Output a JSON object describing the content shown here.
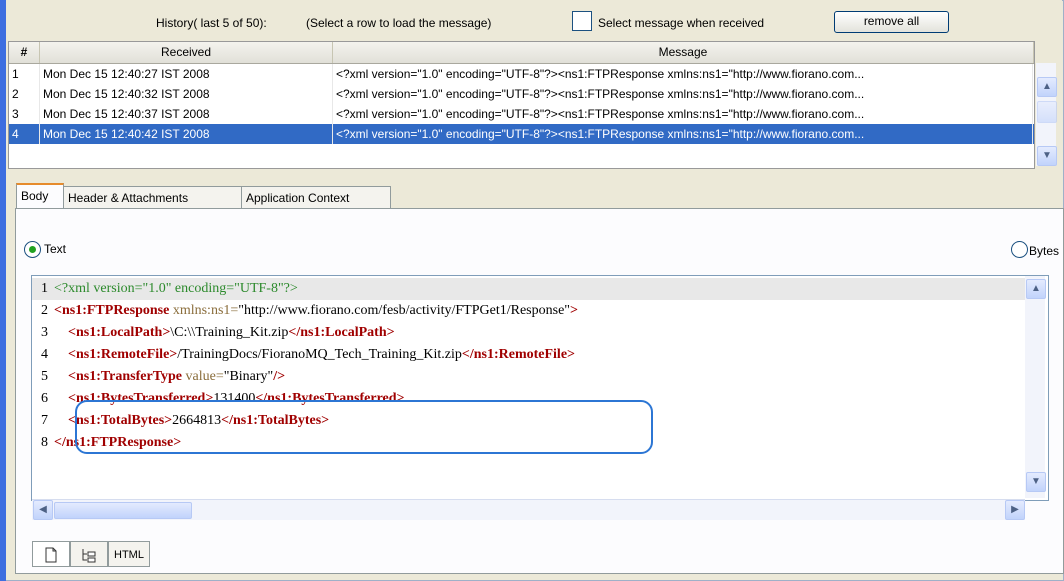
{
  "history": {
    "title": "History( last 5 of 50):",
    "hint": "(Select a row to load the message)",
    "select_when_received_label": "Select message when received",
    "remove_all_label": "remove all"
  },
  "table": {
    "columns": [
      "#",
      "Received",
      "Message"
    ],
    "rows": [
      {
        "num": "1",
        "received": "Mon Dec 15 12:40:27 IST 2008",
        "message": "<?xml version=\"1.0\" encoding=\"UTF-8\"?><ns1:FTPResponse xmlns:ns1=\"http://www.fiorano.com..."
      },
      {
        "num": "2",
        "received": "Mon Dec 15 12:40:32 IST 2008",
        "message": "<?xml version=\"1.0\" encoding=\"UTF-8\"?><ns1:FTPResponse xmlns:ns1=\"http://www.fiorano.com..."
      },
      {
        "num": "3",
        "received": "Mon Dec 15 12:40:37 IST 2008",
        "message": "<?xml version=\"1.0\" encoding=\"UTF-8\"?><ns1:FTPResponse xmlns:ns1=\"http://www.fiorano.com..."
      },
      {
        "num": "4",
        "received": "Mon Dec 15 12:40:42 IST 2008",
        "message": "<?xml version=\"1.0\" encoding=\"UTF-8\"?><ns1:FTPResponse xmlns:ns1=\"http://www.fiorano.com..."
      }
    ],
    "selected_row": 4
  },
  "tabs": [
    "Body",
    "Header & Attachments",
    "Application Context"
  ],
  "active_tab": "Body",
  "format": {
    "text_label": "Text",
    "bytes_label": "Bytes",
    "selected": "Text"
  },
  "editor": {
    "lines": [
      {
        "n": "1",
        "parts": [
          [
            "pi",
            "<?xml version=\"1.0\" encoding=\"UTF-8\"?>"
          ]
        ]
      },
      {
        "n": "2",
        "parts": [
          [
            "tag",
            "<ns1:FTPResponse"
          ],
          [
            "attr",
            " xmlns:ns1="
          ],
          [
            "str",
            "\"http://www.fiorano.com/fesb/activity/FTPGet1/Response\""
          ],
          [
            "tag",
            ">"
          ]
        ]
      },
      {
        "n": "3",
        "parts": [
          [
            "str",
            "    "
          ],
          [
            "tag",
            "<ns1:LocalPath>"
          ],
          [
            "str",
            "\\C:\\\\Training_Kit.zip"
          ],
          [
            "tag",
            "</ns1:LocalPath>"
          ]
        ]
      },
      {
        "n": "4",
        "parts": [
          [
            "str",
            "    "
          ],
          [
            "tag",
            "<ns1:RemoteFile>"
          ],
          [
            "str",
            "/TrainingDocs/FioranoMQ_Tech_Training_Kit.zip"
          ],
          [
            "tag",
            "</ns1:RemoteFile>"
          ]
        ]
      },
      {
        "n": "5",
        "parts": [
          [
            "str",
            "    "
          ],
          [
            "tag",
            "<ns1:TransferType"
          ],
          [
            "attr",
            " value="
          ],
          [
            "str",
            "\"Binary\""
          ],
          [
            "tag",
            "/>"
          ]
        ]
      },
      {
        "n": "6",
        "parts": [
          [
            "str",
            "    "
          ],
          [
            "tag",
            "<ns1:BytesTransferred>"
          ],
          [
            "str",
            "131400"
          ],
          [
            "tag",
            "</ns1:BytesTransferred>"
          ]
        ]
      },
      {
        "n": "7",
        "parts": [
          [
            "str",
            "    "
          ],
          [
            "tag",
            "<ns1:TotalBytes>"
          ],
          [
            "str",
            "2664813"
          ],
          [
            "tag",
            "</ns1:TotalBytes>"
          ]
        ]
      },
      {
        "n": "8",
        "parts": [
          [
            "tag",
            "</ns1:FTPResponse>"
          ]
        ]
      }
    ]
  },
  "bottom_tabs": [
    "",
    "",
    "HTML"
  ],
  "colors": {
    "selection": "#316ac5",
    "tag": "#a00000",
    "highlight_box": "#2c76d4",
    "accent_bar": "#3d6ee0"
  }
}
